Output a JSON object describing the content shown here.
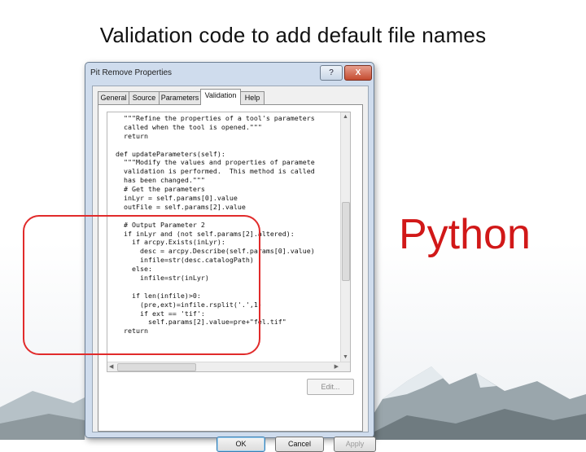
{
  "slide": {
    "title": "Validation code to add default file names",
    "callout": "Python"
  },
  "dialog": {
    "title": "Pit Remove Properties",
    "help_button": "?",
    "close_button": "X",
    "tabs": [
      {
        "label": "General",
        "active": false
      },
      {
        "label": "Source",
        "active": false
      },
      {
        "label": "Parameters",
        "active": false
      },
      {
        "label": "Validation",
        "active": true
      },
      {
        "label": "Help",
        "active": false
      }
    ],
    "code_lines": [
      "  \"\"\"Refine the properties of a tool's parameters",
      "  called when the tool is opened.\"\"\"",
      "  return",
      "",
      "def updateParameters(self):",
      "  \"\"\"Modify the values and properties of paramete",
      "  validation is performed.  This method is called",
      "  has been changed.\"\"\"",
      "  # Get the parameters",
      "  inLyr = self.params[0].value",
      "  outFile = self.params[2].value",
      "",
      "  # Output Parameter 2",
      "  if inLyr and (not self.params[2].altered):",
      "    if arcpy.Exists(inLyr):",
      "      desc = arcpy.Describe(self.params[0].value)",
      "      infile=str(desc.catalogPath)",
      "    else:",
      "      infile=str(inLyr)",
      "",
      "    if len(infile)>0:",
      "      (pre,ext)=infile.rsplit('.',1)",
      "      if ext == 'tif':",
      "        self.params[2].value=pre+\"fel.tif\"",
      "  return"
    ],
    "edit_button": "Edit...",
    "buttons": {
      "ok": "OK",
      "cancel": "Cancel",
      "apply": "Apply"
    }
  },
  "colors": {
    "highlight": "#e12b2b",
    "callout": "#d11818"
  }
}
